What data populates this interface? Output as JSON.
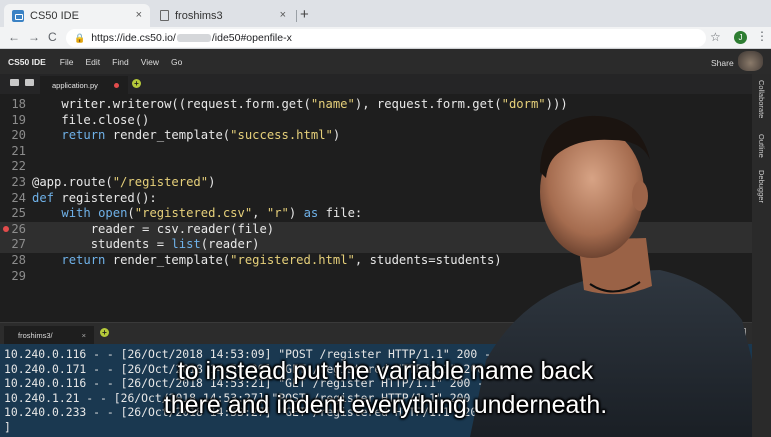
{
  "browser": {
    "tabs": [
      {
        "title": "CS50 IDE",
        "close": "×"
      },
      {
        "title": "froshims3",
        "close": "×"
      }
    ],
    "new_tab": "+",
    "nav": {
      "back": "←",
      "forward": "→",
      "reload": "C"
    },
    "lock": "🔒",
    "url_prefix": "https://ide.cs50.io/",
    "url_suffix": "/ide50#openfile-x",
    "star": "☆",
    "profile_initial": "J",
    "menu": "⋮"
  },
  "ide": {
    "brand": "CS50 IDE",
    "menu": [
      "File",
      "Edit",
      "Find",
      "View",
      "Go"
    ],
    "share": "Share",
    "file_tab": "application.py",
    "add": "+",
    "side_panels": [
      "Collaborate",
      "Outline",
      "Debugger"
    ]
  },
  "editor": {
    "lines": [
      {
        "num": "18",
        "segments": [
          {
            "t": "    writer.writerow((request.form.get(",
            "c": ""
          },
          {
            "t": "\"name\"",
            "c": "str"
          },
          {
            "t": "), request.form.get(",
            "c": ""
          },
          {
            "t": "\"dorm\"",
            "c": "str"
          },
          {
            "t": ")))",
            "c": ""
          }
        ]
      },
      {
        "num": "19",
        "segments": [
          {
            "t": "    file.close()",
            "c": ""
          }
        ]
      },
      {
        "num": "20",
        "segments": [
          {
            "t": "    ",
            "c": ""
          },
          {
            "t": "return",
            "c": "kw"
          },
          {
            "t": " render_template(",
            "c": ""
          },
          {
            "t": "\"success.html\"",
            "c": "str"
          },
          {
            "t": ")",
            "c": ""
          }
        ]
      },
      {
        "num": "21",
        "segments": []
      },
      {
        "num": "22",
        "segments": []
      },
      {
        "num": "23",
        "segments": [
          {
            "t": "@app.route(",
            "c": ""
          },
          {
            "t": "\"/registered\"",
            "c": "str"
          },
          {
            "t": ")",
            "c": ""
          }
        ]
      },
      {
        "num": "24",
        "segments": [
          {
            "t": "def",
            "c": "kw"
          },
          {
            "t": " registered():",
            "c": ""
          }
        ]
      },
      {
        "num": "25",
        "segments": [
          {
            "t": "    ",
            "c": ""
          },
          {
            "t": "with",
            "c": "kw"
          },
          {
            "t": " ",
            "c": ""
          },
          {
            "t": "open",
            "c": "kw"
          },
          {
            "t": "(",
            "c": ""
          },
          {
            "t": "\"registered.csv\"",
            "c": "str"
          },
          {
            "t": ", ",
            "c": ""
          },
          {
            "t": "\"r\"",
            "c": "str"
          },
          {
            "t": ") ",
            "c": ""
          },
          {
            "t": "as",
            "c": "kw"
          },
          {
            "t": " file:",
            "c": ""
          }
        ]
      },
      {
        "num": "26",
        "segments": [
          {
            "t": "        reader = csv.reader(file)",
            "c": ""
          }
        ],
        "highlight": true,
        "breakpoint": true
      },
      {
        "num": "27",
        "segments": [
          {
            "t": "        students = ",
            "c": ""
          },
          {
            "t": "list",
            "c": "kw"
          },
          {
            "t": "(reader)",
            "c": ""
          }
        ],
        "highlight": true
      },
      {
        "num": "28",
        "segments": [
          {
            "t": "    ",
            "c": ""
          },
          {
            "t": "return",
            "c": "kw"
          },
          {
            "t": " render_template(",
            "c": ""
          },
          {
            "t": "\"registered.html\"",
            "c": "str"
          },
          {
            "t": ", students=students)",
            "c": ""
          }
        ]
      },
      {
        "num": "29",
        "segments": []
      }
    ]
  },
  "terminal": {
    "tab": "froshims3/",
    "close": "×",
    "add": "+",
    "lines": [
      "10.240.0.116 - - [26/Oct/2018 14:53:09] \"POST /register HTTP/1.1\" 200 -",
      "10.240.0.171 - - [26/Oct/2018 14:53:09] \"GET /registered HTTP/1.1\" 200 -",
      "10.240.0.116 - - [26/Oct/2018 14:53:21] \"GET /register HTTP/1.1\" 200 -",
      "10.240.1.21 - - [26/Oct/2018 14:53:27] \"POST /register HTTP/1.1\" 200 -",
      "10.240.0.233 - - [26/Oct/2018 14:53:27] \"GET /registered HTTP/1.1\" 200 -",
      "]"
    ]
  },
  "captions": [
    "to instead put the variable name back",
    "there and indent everything underneath."
  ]
}
